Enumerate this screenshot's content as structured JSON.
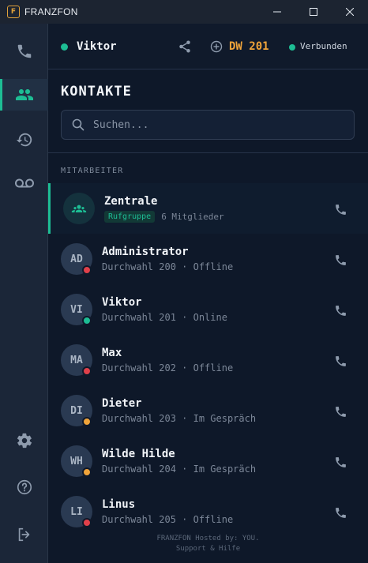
{
  "window": {
    "logo_letter": "F",
    "title": "FRANZFON"
  },
  "header": {
    "user_name": "Viktor",
    "user_status_color": "#1dbd94",
    "extension": "DW 201",
    "connection_label": "Verbunden"
  },
  "page": {
    "title": "KONTAKTE",
    "search_placeholder": "Suchen...",
    "section_label": "MITARBEITER"
  },
  "group": {
    "name": "Zentrale",
    "badge": "Rufgruppe",
    "members": "6 Mitglieder",
    "icon": "users-icon"
  },
  "contacts": [
    {
      "initials": "AD",
      "name": "Administrator",
      "subtitle": "Durchwahl 200 · Offline",
      "status_color": "#e0404a"
    },
    {
      "initials": "VI",
      "name": "Viktor",
      "subtitle": "Durchwahl 201 · Online",
      "status_color": "#1dbd94"
    },
    {
      "initials": "MA",
      "name": "Max",
      "subtitle": "Durchwahl 202 · Offline",
      "status_color": "#e0404a"
    },
    {
      "initials": "DI",
      "name": "Dieter",
      "subtitle": "Durchwahl 203 · Im Gespräch",
      "status_color": "#f0a43a"
    },
    {
      "initials": "WH",
      "name": "Wilde Hilde",
      "subtitle": "Durchwahl 204 · Im Gespräch",
      "status_color": "#f0a43a"
    },
    {
      "initials": "LI",
      "name": "Linus",
      "subtitle": "Durchwahl 205 · Offline",
      "status_color": "#e0404a"
    }
  ],
  "footer": {
    "line1": "FRANZFON Hosted by: YOU.",
    "line2": "Support & Hilfe"
  },
  "colors": {
    "accent": "#1dbd94",
    "extension": "#f0a43a",
    "background": "#0e1829",
    "sidebar": "#1b2638"
  },
  "sidebar_icons": [
    "phone-icon",
    "contacts-icon",
    "history-icon",
    "voicemail-icon",
    "settings-icon",
    "help-icon",
    "logout-icon"
  ]
}
